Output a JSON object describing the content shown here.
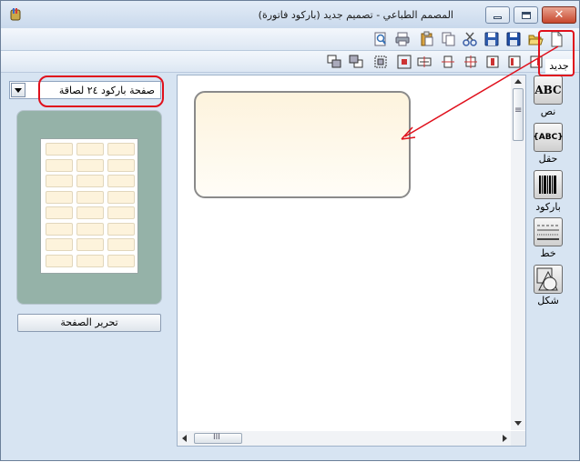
{
  "window": {
    "title": "المصمم الطباعي - تصميم جديد (باركود فاتورة)",
    "close_glyph": "✕"
  },
  "toolbar": {
    "new_label": "جديد",
    "row1_icons": [
      "new-document-icon",
      "open-icon",
      "save-icon",
      "save-as-icon",
      "cut-icon",
      "copy-icon",
      "paste-icon",
      "print-icon",
      "print-preview-icon"
    ],
    "row2_icons": [
      "align-right-icon",
      "align-left-icon",
      "align-center-icon",
      "align-middle-icon",
      "distribute-h-icon",
      "distribute-v-icon",
      "center-icon",
      "fit-icon",
      "bring-front-icon",
      "send-back-icon"
    ]
  },
  "left_panel": {
    "page_select": {
      "value": "صفحة باركود ٢٤ لصاقة"
    },
    "preview": {
      "rows": 8,
      "cols": 3
    },
    "edit_page_button": "تحرير الصفحة"
  },
  "palette": {
    "tools": [
      {
        "label": "نص",
        "icon_text": "ABC",
        "icon": "text-tool-icon"
      },
      {
        "label": "حقل",
        "icon_text": "{ABC}",
        "icon": "field-tool-icon"
      },
      {
        "label": "باركود",
        "icon_text": "",
        "icon": "barcode-tool-icon"
      },
      {
        "label": "خط",
        "icon_text": "",
        "icon": "line-tool-icon"
      },
      {
        "label": "شكل",
        "icon_text": "",
        "icon": "shape-tool-icon"
      }
    ]
  },
  "scrollbar": {
    "grip": "III",
    "vgrip": "≡"
  },
  "colors": {
    "annotation": "#e0101c",
    "label_fill": "#fdf3dd",
    "preview_bg": "#95b2a8"
  }
}
